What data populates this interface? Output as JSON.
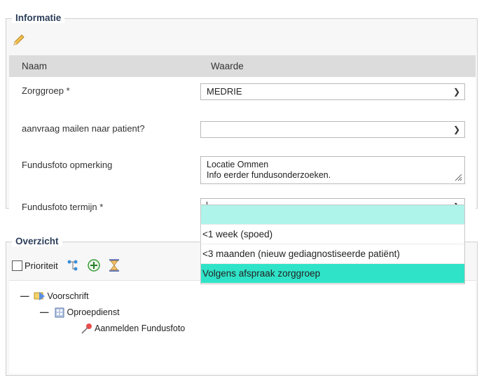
{
  "info": {
    "legend": "Informatie",
    "edit_icon": "pencil-icon",
    "columns": {
      "name": "Naam",
      "value": "Waarde"
    },
    "rows": {
      "zorggroep": {
        "label": "Zorggroep *",
        "value": "MEDRIE"
      },
      "mailen": {
        "label": "aanvraag mailen naar patient?",
        "value": ""
      },
      "opmerking": {
        "label": "Fundusfoto opmerking",
        "line1": "Locatie Ommen",
        "line2": "Info eerder fundusonderzoeken."
      },
      "termijn": {
        "label": "Fundusfoto termijn *",
        "value": ""
      }
    }
  },
  "dropdown": {
    "options": [
      "",
      "<1 week (spoed)",
      "<3 maanden (nieuw gediagnostiseerde patiënt)",
      "Volgens afspraak zorggroep"
    ],
    "highlighted": "Volgens afspraak zorggroep"
  },
  "overview": {
    "legend": "Overzicht",
    "priority_label": "Prioriteit",
    "toolbar_icons": [
      "hierarchy-icon",
      "add-circle-icon",
      "hourglass-icon"
    ],
    "tree": {
      "root": "Voorschrift",
      "child": "Oproepdienst",
      "leaf": "Aanmelden Fundusfoto"
    }
  },
  "colors": {
    "accent": "#2fe3c8",
    "accent_light": "#aef4ea",
    "legend_text": "#2c3e5a"
  }
}
